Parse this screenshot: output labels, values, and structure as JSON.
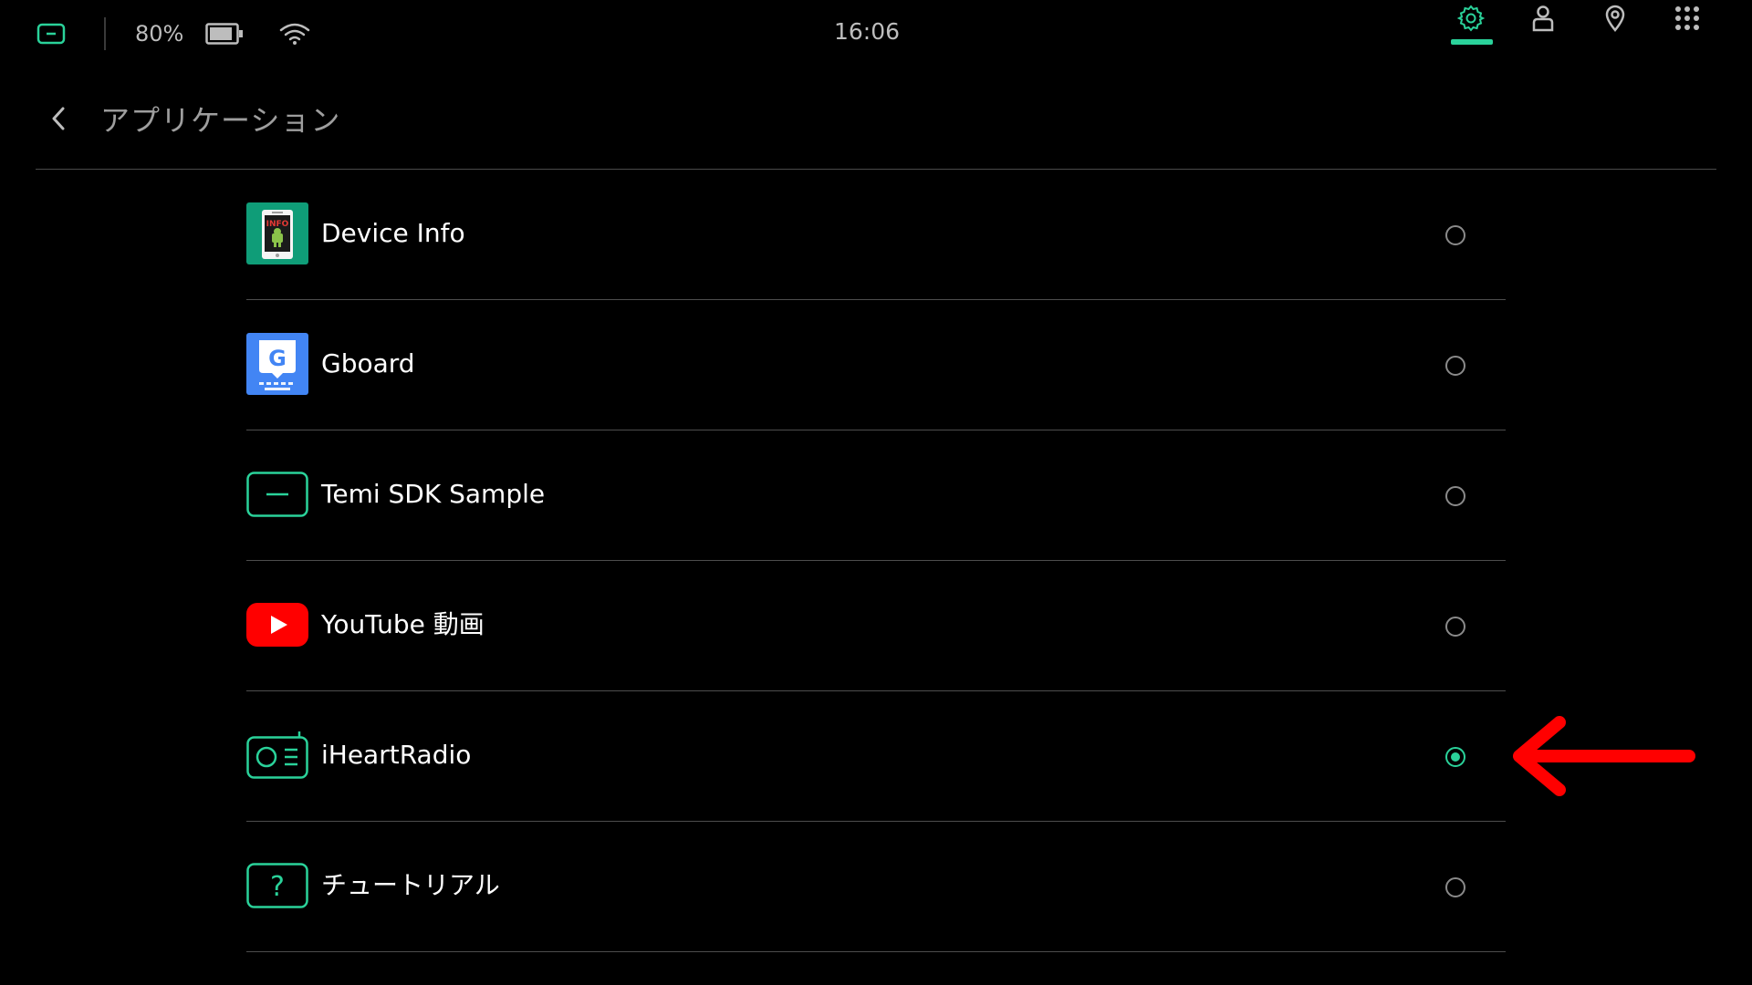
{
  "status_bar": {
    "battery_percent": "80%",
    "time": "16:06",
    "icons": [
      "temi-home-icon",
      "battery-icon",
      "wifi-icon",
      "settings-gear-icon",
      "user-icon",
      "location-pin-icon",
      "apps-grid-icon"
    ],
    "active_tab": "settings",
    "accent_color": "#2ad29a"
  },
  "header": {
    "back_icon": "chevron-left-icon",
    "title": "アプリケーション"
  },
  "apps": [
    {
      "label": "Device Info",
      "icon": "device-info-icon",
      "selected": false
    },
    {
      "label": "Gboard",
      "icon": "gboard-icon",
      "selected": false
    },
    {
      "label": "Temi SDK Sample",
      "icon": "temi-sdk-icon",
      "selected": false
    },
    {
      "label": "YouTube 動画",
      "icon": "youtube-icon",
      "selected": false
    },
    {
      "label": "iHeartRadio",
      "icon": "radio-icon",
      "selected": true
    },
    {
      "label": "チュートリアル",
      "icon": "question-icon",
      "selected": false
    }
  ],
  "annotation": {
    "arrow_color": "#ff0000",
    "points_to": "iHeartRadio"
  }
}
